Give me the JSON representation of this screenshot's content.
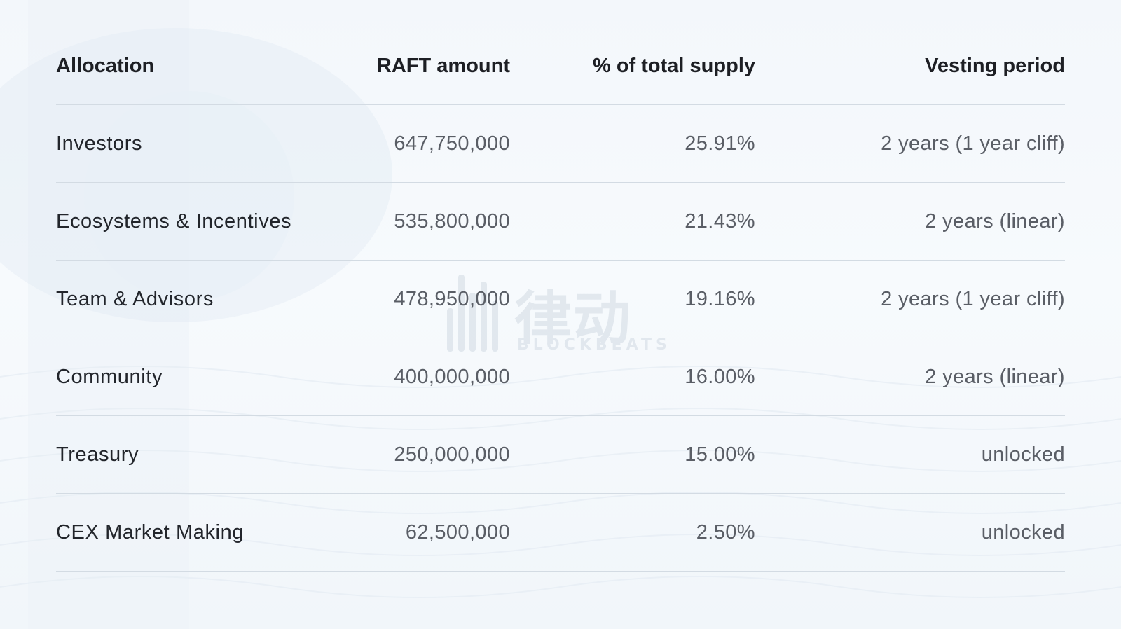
{
  "table": {
    "headers": [
      "Allocation",
      "RAFT amount",
      "% of total supply",
      "Vesting period"
    ],
    "rows": [
      {
        "allocation": "Investors",
        "amount": "647,750,000",
        "percent": "25.91%",
        "vesting": "2 years (1 year cliff)"
      },
      {
        "allocation": "Ecosystems & Incentives",
        "amount": "535,800,000",
        "percent": "21.43%",
        "vesting": "2 years (linear)"
      },
      {
        "allocation": "Team & Advisors",
        "amount": "478,950,000",
        "percent": "19.16%",
        "vesting": "2 years (1 year cliff)"
      },
      {
        "allocation": "Community",
        "amount": "400,000,000",
        "percent": "16.00%",
        "vesting": "2 years (linear)"
      },
      {
        "allocation": "Treasury",
        "amount": "250,000,000",
        "percent": "15.00%",
        "vesting": "unlocked"
      },
      {
        "allocation": "CEX Market Making",
        "amount": "62,500,000",
        "percent": "2.50%",
        "vesting": "unlocked"
      }
    ]
  },
  "watermark": {
    "text": "律动",
    "subtext": "BLOCKBEATS",
    "icon": "blockbeats-logo-icon"
  },
  "colors": {
    "header_text": "#1d1f24",
    "label_text": "#22252b",
    "value_text": "#5a5e66",
    "divider": "#d3dbe3",
    "background": "#f4f8fb"
  }
}
